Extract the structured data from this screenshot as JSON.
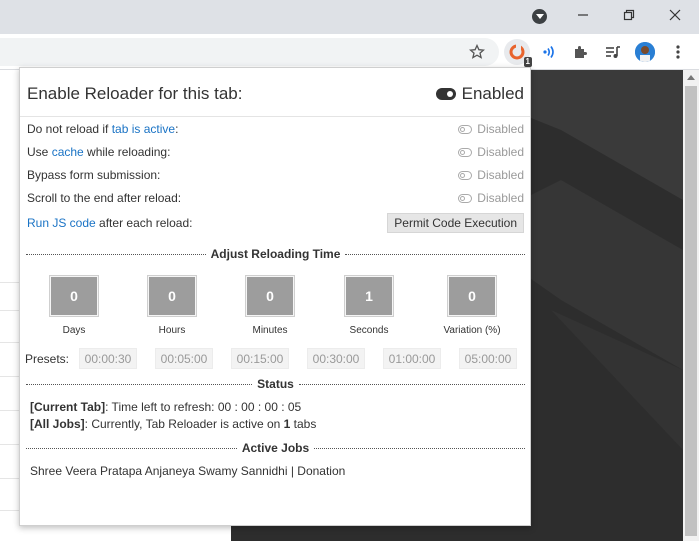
{
  "browser": {
    "icons": {
      "profile_dropdown": "chevron-down-icon",
      "minimize": "minimize-icon",
      "restore": "restore-icon",
      "close": "close-icon",
      "star": "star-icon",
      "extension_active": "tab-reloader-icon",
      "extension_badge": "1",
      "wifi": "signal-icon",
      "puzzle": "extensions-icon",
      "media": "media-queue-icon",
      "avatar": "avatar",
      "menu": "kebab-menu-icon"
    }
  },
  "popup": {
    "header": {
      "title": "Enable Reloader for this tab:",
      "status": "Enabled"
    },
    "options": [
      {
        "label_pre": "Do not reload if ",
        "label_link": "tab is active",
        "label_post": ":",
        "state": "Disabled"
      },
      {
        "label_pre": "Use ",
        "label_link": "cache",
        "label_post": " while reloading:",
        "state": "Disabled"
      },
      {
        "label_pre": "Bypass form submission:",
        "label_link": "",
        "label_post": "",
        "state": "Disabled"
      },
      {
        "label_pre": "Scroll to the end after reload:",
        "label_link": "",
        "label_post": "",
        "state": "Disabled"
      }
    ],
    "js_row": {
      "label_link": "Run JS code",
      "label_post": " after each reload:",
      "button": "Permit Code Execution"
    },
    "reload_section": {
      "title": "Adjust Reloading Time",
      "counters": [
        {
          "value": "0",
          "caption": "Days"
        },
        {
          "value": "0",
          "caption": "Hours"
        },
        {
          "value": "0",
          "caption": "Minutes"
        },
        {
          "value": "1",
          "caption": "Seconds"
        },
        {
          "value": "0",
          "caption": "Variation (%)"
        }
      ],
      "presets_label": "Presets:",
      "presets": [
        "00:00:30",
        "00:05:00",
        "00:15:00",
        "00:30:00",
        "01:00:00",
        "05:00:00"
      ]
    },
    "status_section": {
      "title": "Status",
      "current_tab_label": "[Current Tab]",
      "current_tab_text": ": Time left to refresh: 00 : 00 : 00 : 05",
      "all_jobs_label": "[All Jobs]",
      "all_jobs_text_pre": ": Currently, Tab Reloader is active on ",
      "all_jobs_count": "1",
      "all_jobs_text_post": " tabs"
    },
    "active_jobs_section": {
      "title": "Active Jobs",
      "jobs": [
        "Shree Veera Pratapa Anjaneya Swamy Sannidhi | Donation"
      ]
    }
  }
}
